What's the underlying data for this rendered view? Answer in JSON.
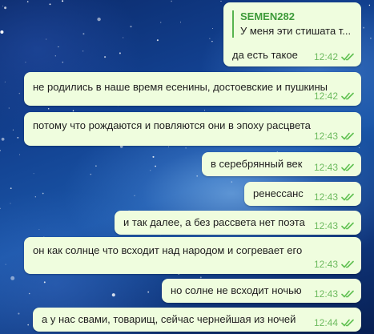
{
  "chat": {
    "messages": [
      {
        "reply": {
          "author": "SEMEN282",
          "text": "У меня эти стишата т..."
        },
        "text": "да есть такое",
        "time": "12:42",
        "status": "read"
      },
      {
        "text": "не родились в наше время есенины, достоевские и пушкины",
        "time": "12:42",
        "status": "read"
      },
      {
        "text": "потому что рождаются и повляются они в эпоху расцвета",
        "time": "12:43",
        "status": "read"
      },
      {
        "text": "в серебрянный век",
        "time": "12:43",
        "status": "read"
      },
      {
        "text": "ренессанс",
        "time": "12:43",
        "status": "read"
      },
      {
        "text": "и так далее, а без рассвета нет поэта",
        "time": "12:43",
        "status": "read"
      },
      {
        "text": "он как солнце что всходит над народом и согревает его",
        "time": "12:43",
        "status": "read"
      },
      {
        "text": "но солне не всходит ночью",
        "time": "12:43",
        "status": "read"
      },
      {
        "text": "а у нас свами, товарищ, сейчас чернейшая из ночей",
        "time": "12:44",
        "status": "read"
      }
    ]
  },
  "colors": {
    "bubble_bg": "#effdde",
    "time": "#6dbb5f",
    "check": "#5fc050",
    "reply_bar": "#56b44e",
    "reply_author": "#3e9b3a"
  },
  "icons": {
    "read_status": "double-check-icon"
  }
}
